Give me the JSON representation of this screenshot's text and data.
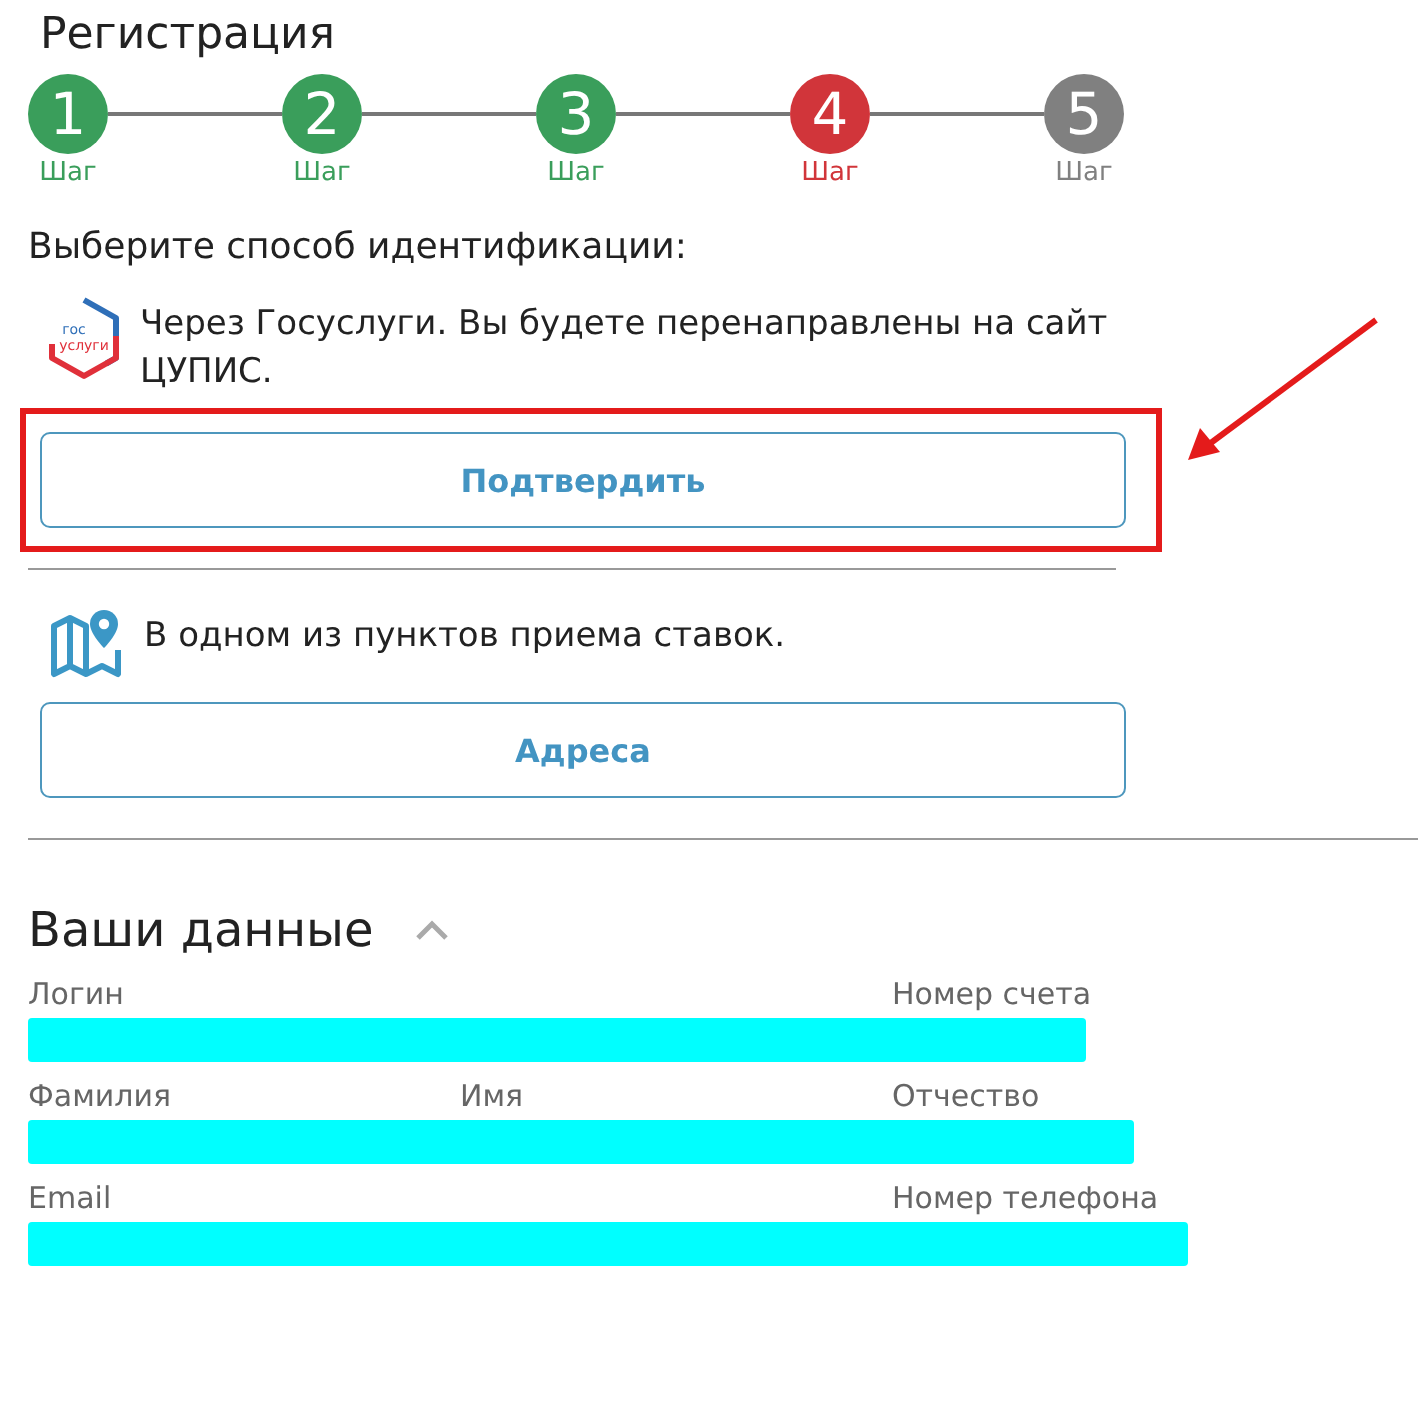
{
  "title": "Регистрация",
  "steps": [
    {
      "number": "1",
      "label": "Шаг",
      "color": "#3a9e5b"
    },
    {
      "number": "2",
      "label": "Шаг",
      "color": "#3a9e5b"
    },
    {
      "number": "3",
      "label": "Шаг",
      "color": "#3a9e5b"
    },
    {
      "number": "4",
      "label": "Шаг",
      "color": "#d1353a"
    },
    {
      "number": "5",
      "label": "Шаг",
      "color": "#808080"
    }
  ],
  "identification": {
    "prompt": "Выберите способ идентификации:",
    "methods": [
      {
        "kind": "gosuslugi",
        "logo_text": [
          "гос",
          "услуги"
        ],
        "text": "Через Госуслуги. Вы будете перенаправлены на сайт ЦУПИС.",
        "button": "Подтвердить",
        "highlighted": true
      },
      {
        "kind": "map",
        "text": "В одном из пунктов приема ставок.",
        "button": "Адреса",
        "highlighted": false
      }
    ]
  },
  "your_data": {
    "title": "Ваши данные",
    "expanded": true,
    "rows": [
      {
        "fields": [
          {
            "label": "Логин",
            "kind": "wide"
          },
          {
            "label": "Номер счета",
            "kind": "normal"
          }
        ],
        "redacted": true
      },
      {
        "fields": [
          {
            "label": "Фамилия",
            "kind": "normal"
          },
          {
            "label": "Имя",
            "kind": "normal"
          },
          {
            "label": "Отчество",
            "kind": "normal"
          }
        ],
        "redacted": true
      },
      {
        "fields": [
          {
            "label": "Email",
            "kind": "wide"
          },
          {
            "label": "Номер телефона",
            "kind": "normal"
          }
        ],
        "redacted": true
      }
    ]
  }
}
